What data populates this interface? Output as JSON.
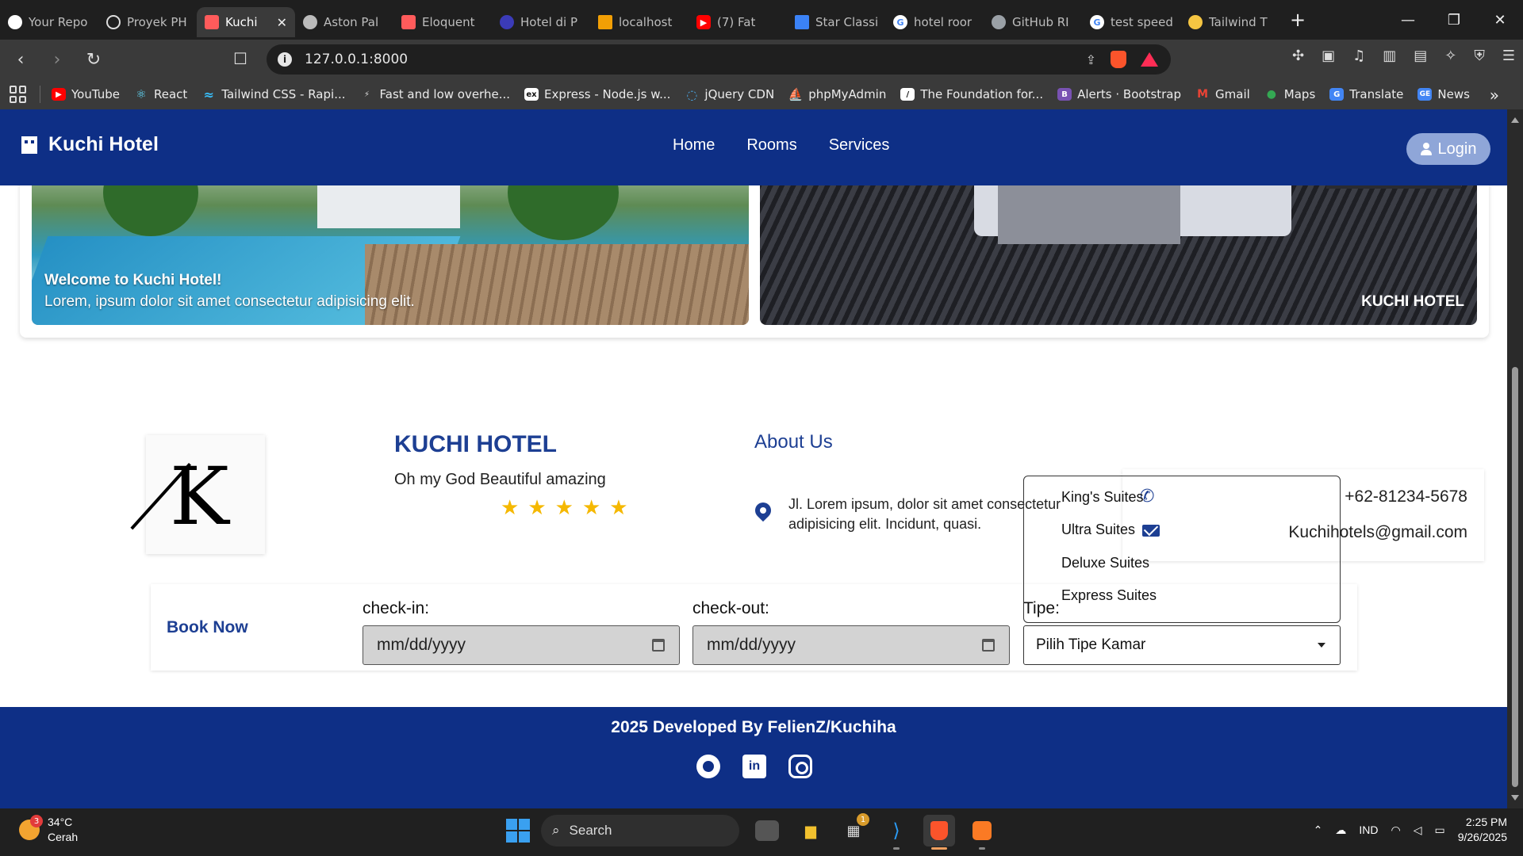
{
  "browser": {
    "tabs": [
      {
        "label": "Your Repo",
        "icon": "github-icon",
        "color": "#ffffff",
        "active": false
      },
      {
        "label": "Proyek PH",
        "icon": "openai-icon",
        "color": "#ffffff",
        "active": false
      },
      {
        "label": "Kuchi",
        "icon": "laravel-icon",
        "color": "#ff5b5b",
        "active": true
      },
      {
        "label": "Aston Pal",
        "icon": "globe-icon",
        "color": "#cccccc",
        "active": false
      },
      {
        "label": "Eloquent",
        "icon": "laravel-icon",
        "color": "#ff5b5b",
        "active": false
      },
      {
        "label": "Hotel di P",
        "icon": "bookmark-icon",
        "color": "#3b3bb8",
        "active": false
      },
      {
        "label": "localhost",
        "icon": "phpmyadmin-icon",
        "color": "#f29f05",
        "active": false
      },
      {
        "label": "(7) Fat",
        "icon": "youtube-icon",
        "color": "#ff0000",
        "active": false
      },
      {
        "label": "Star Classi",
        "icon": "flag-icon",
        "color": "#3b82f6",
        "active": false
      },
      {
        "label": "hotel roor",
        "icon": "google-icon",
        "color": "#ffffff",
        "active": false
      },
      {
        "label": "GitHub RI",
        "icon": "copilot-icon",
        "color": "#9aa0a6",
        "active": false
      },
      {
        "label": "test speed",
        "icon": "google-icon",
        "color": "#ffffff",
        "active": false
      },
      {
        "label": "Tailwind T",
        "icon": "emoji-icon",
        "color": "#f5c542",
        "active": false
      }
    ],
    "url": "127.0.0.1:8000",
    "bookmarks": [
      {
        "label": "YouTube",
        "color": "#ff0000",
        "glyph": "▶"
      },
      {
        "label": "React",
        "color": "#61dafb",
        "glyph": "⚛"
      },
      {
        "label": "Tailwind CSS - Rapi...",
        "color": "#38bdf8",
        "glyph": "~"
      },
      {
        "label": "Fast and low overhe...",
        "color": "#444444",
        "glyph": "⚡"
      },
      {
        "label": "Express - Node.js w...",
        "color": "#ffffff",
        "glyph": "ex"
      },
      {
        "label": "jQuery CDN",
        "color": "#0769ad",
        "glyph": "j"
      },
      {
        "label": "phpMyAdmin",
        "color": "#f29f05",
        "glyph": "⛵"
      },
      {
        "label": "The Foundation for...",
        "color": "#ffffff",
        "glyph": "/"
      },
      {
        "label": "Alerts · Bootstrap",
        "color": "#7952b3",
        "glyph": "B"
      },
      {
        "label": "Gmail",
        "color": "#ea4335",
        "glyph": "M"
      },
      {
        "label": "Maps",
        "color": "#34a853",
        "glyph": "●"
      },
      {
        "label": "Translate",
        "color": "#4285f4",
        "glyph": "G"
      },
      {
        "label": "News",
        "color": "#4285f4",
        "glyph": "GE"
      }
    ]
  },
  "site": {
    "brand": "Kuchi Hotel",
    "nav": [
      "Home",
      "Rooms",
      "Services"
    ],
    "login": "Login",
    "slides": [
      {
        "title": "Welcome to Kuchi Hotel!",
        "text": "Lorem, ipsum dolor sit amet consectetur adipisicing elit."
      },
      {
        "caption": "KUCHI HOTEL"
      }
    ],
    "logo_letter": "K",
    "hotel_name": "KUCHI HOTEL",
    "tagline": "Oh my God Beautiful amazing",
    "rating": {
      "value": 5,
      "max": 5,
      "glyph": "★"
    },
    "about_title": "About Us",
    "address": "Jl. Lorem ipsum, dolor sit amet consectetur adipisicing elit. Incidunt, quasi.",
    "phone": "+62-81234-5678",
    "email": "Kuchihotels@gmail.com",
    "booking": {
      "title": "Book Now",
      "checkin_label": "check-in:",
      "checkout_label": "check-out:",
      "date_placeholder": "mm/dd/yyyy",
      "type_label": "Tipe:",
      "type_selected": "Pilih Tipe Kamar",
      "type_options": [
        "King's Suites",
        "Ultra Suites",
        "Deluxe Suites",
        "Express Suites"
      ]
    },
    "footer": "2025 Developed By FelienZ/Kuchiha"
  },
  "taskbar": {
    "weather_temp": "34°C",
    "weather_desc": "Cerah",
    "weather_badge": "3",
    "search": "Search",
    "store_badge": "1",
    "lang": "IND",
    "time": "2:25 PM",
    "date": "9/26/2025"
  },
  "colors": {
    "brand_blue": "#0e2f86",
    "heading_blue": "#1d3f93",
    "star": "#f5b800"
  }
}
